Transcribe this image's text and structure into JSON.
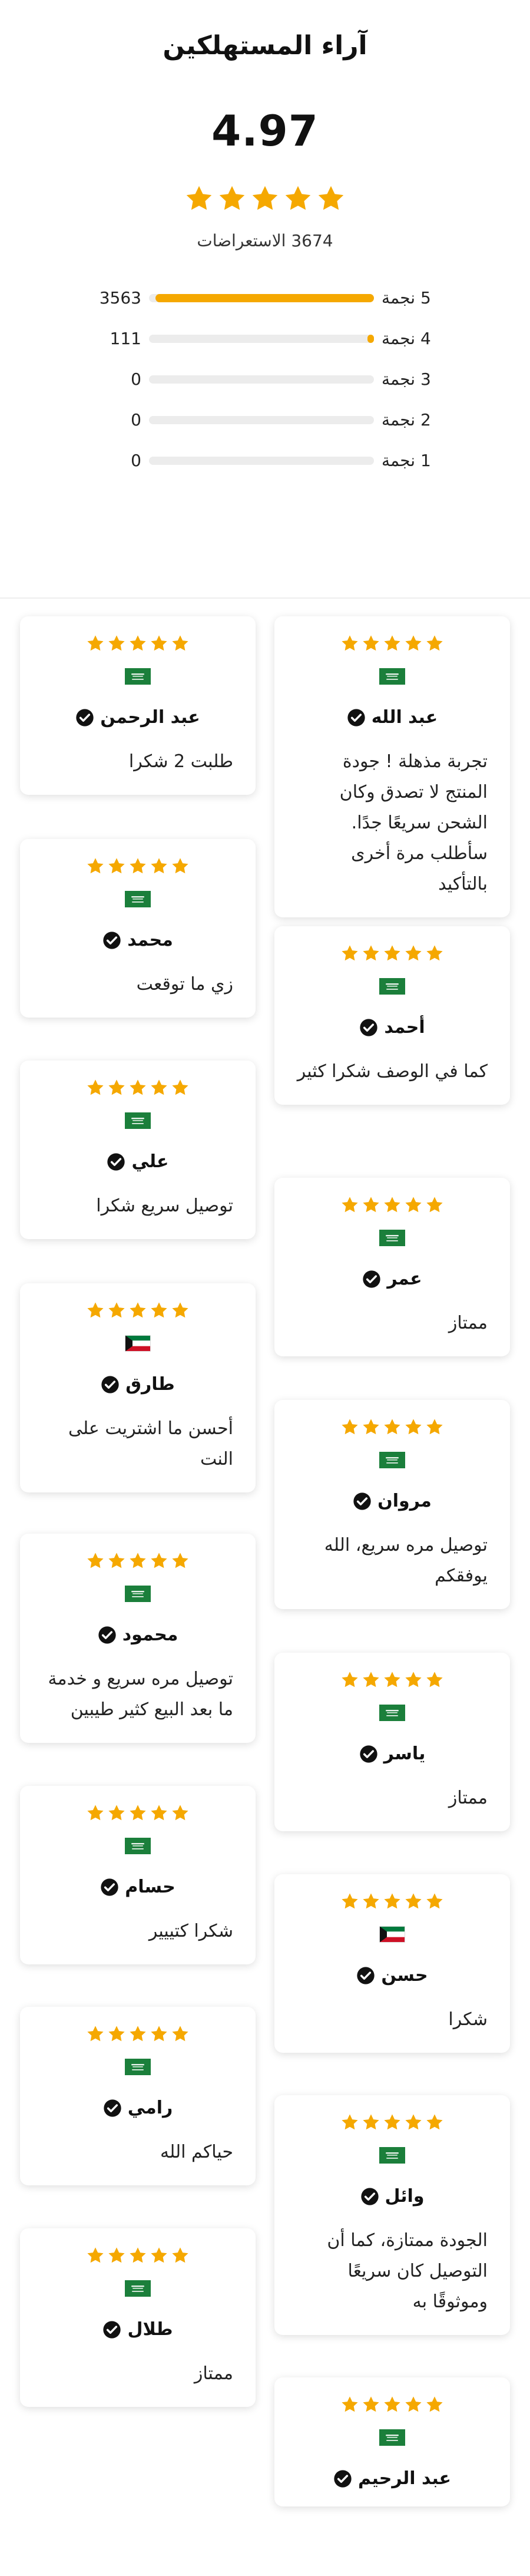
{
  "header": {
    "title": "آراء المستهلكين"
  },
  "summary": {
    "average": "4.97",
    "stars": 5,
    "total_reviews_text": "3674 الاستعراضات"
  },
  "histogram": [
    {
      "label": "5 نجمة",
      "count": "3563",
      "fraction": 0.97
    },
    {
      "label": "4 نجمة",
      "count": "111",
      "fraction": 0.03
    },
    {
      "label": "3 نجمة",
      "count": "0",
      "fraction": 0
    },
    {
      "label": "2 نجمة",
      "count": "0",
      "fraction": 0
    },
    {
      "label": "1 نجمة",
      "count": "0",
      "fraction": 0
    }
  ],
  "colors": {
    "star": "#f5a800",
    "bar_fill": "#f5a800",
    "bar_track": "#ececec",
    "verified": "#111111"
  },
  "reviews": [
    {
      "name": "عبد الله",
      "flag": "saudi-flag-icon",
      "rating": 5,
      "text": "تجربة مذهلة ! جودة المنتج لا تصدق وكان الشحن سريعًا جدًا. سأطلب مرة أخرى بالتأكيد"
    },
    {
      "name": "عبد الرحمن",
      "flag": "saudi-flag-icon",
      "rating": 5,
      "text": "طلبت 2 شكرا"
    },
    {
      "name": "أحمد",
      "flag": "saudi-flag-icon",
      "rating": 5,
      "text": "كما في الوصف شكرا كثير"
    },
    {
      "name": "محمد",
      "flag": "saudi-flag-icon",
      "rating": 5,
      "text": "زي ما توقعت"
    },
    {
      "name": "عمر",
      "flag": "saudi-flag-icon",
      "rating": 5,
      "text": "ممتاز"
    },
    {
      "name": "علي",
      "flag": "saudi-flag-icon",
      "rating": 5,
      "text": "توصيل سريع شكرا"
    },
    {
      "name": "مروان",
      "flag": "saudi-flag-icon",
      "rating": 5,
      "text": "توصيل مره سريع، الله يوفقكم"
    },
    {
      "name": "طارق",
      "flag": "kuwait-flag-icon",
      "rating": 5,
      "text": "أحسن ما اشتريت على النت"
    },
    {
      "name": "ياسر",
      "flag": "saudi-flag-icon",
      "rating": 5,
      "text": "ممتاز"
    },
    {
      "name": "محمود",
      "flag": "saudi-flag-icon",
      "rating": 5,
      "text": "توصيل مره سريع و خدمة ما بعد البيع كثير طيبين"
    },
    {
      "name": "حسن",
      "flag": "kuwait-flag-icon",
      "rating": 5,
      "text": "شكرا"
    },
    {
      "name": "حسام",
      "flag": "saudi-flag-icon",
      "rating": 5,
      "text": "شكرا كتييير"
    },
    {
      "name": "وائل",
      "flag": "saudi-flag-icon",
      "rating": 5,
      "text": "الجودة ممتازة، كما أن التوصيل كان سريعًا وموثوقًا به"
    },
    {
      "name": "رامي",
      "flag": "saudi-flag-icon",
      "rating": 5,
      "text": "حياكم الله"
    },
    {
      "name": "عبد الرحيم",
      "flag": "saudi-flag-icon",
      "rating": 5,
      "text": ""
    },
    {
      "name": "طلال",
      "flag": "saudi-flag-icon",
      "rating": 5,
      "text": "ممتاز"
    }
  ]
}
